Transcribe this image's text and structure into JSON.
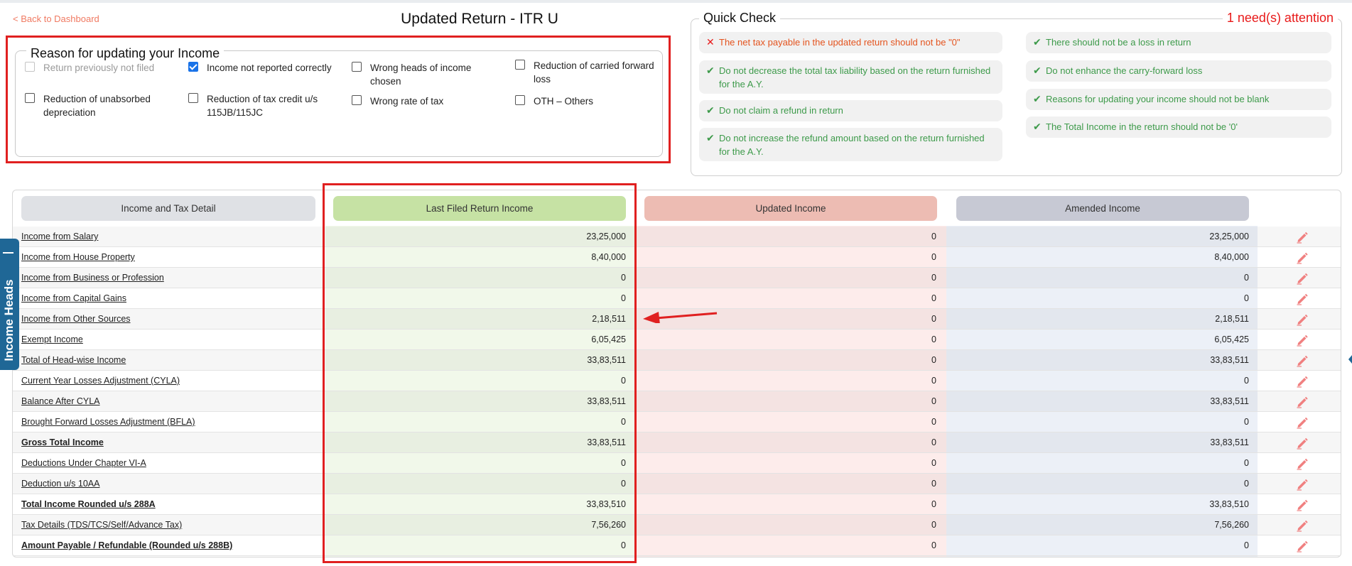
{
  "nav": {
    "back_label": "< Back to Dashboard"
  },
  "page_title": "Updated Return - ITR U",
  "reason": {
    "legend": "Reason for updating your Income",
    "options": [
      {
        "label": "Return previously not filed",
        "checked": false,
        "disabled": true
      },
      {
        "label": "Income not reported correctly",
        "checked": true,
        "disabled": false
      },
      {
        "label": "Wrong heads of income chosen",
        "checked": false,
        "disabled": false
      },
      {
        "label": "Reduction of carried forward loss",
        "checked": false,
        "disabled": false
      },
      {
        "label": "Reduction of unabsorbed depreciation",
        "checked": false,
        "disabled": false
      },
      {
        "label": "Reduction of tax credit u/s 115JB/115JC",
        "checked": false,
        "disabled": false
      },
      {
        "label": "Wrong rate of tax",
        "checked": false,
        "disabled": false
      },
      {
        "label": "OTH – Others",
        "checked": false,
        "disabled": false
      }
    ]
  },
  "quick_check": {
    "title": "Quick Check",
    "attention": "1 need(s) attention",
    "items": [
      {
        "text": "The net tax payable in the updated return should not be \"0\"",
        "status": "error"
      },
      {
        "text": "Do not decrease the total tax liability based on the return furnished for the A.Y.",
        "status": "ok"
      },
      {
        "text": "Do not claim a refund in return",
        "status": "ok"
      },
      {
        "text": "Do not increase the refund amount based on the return furnished for the A.Y.",
        "status": "ok"
      },
      {
        "text": "There should not be a loss in return",
        "status": "ok"
      },
      {
        "text": "Do not enhance the carry-forward loss",
        "status": "ok"
      },
      {
        "text": "Reasons for updating your income should not be blank",
        "status": "ok"
      },
      {
        "text": "The Total Income in the return should not be '0'",
        "status": "ok"
      }
    ]
  },
  "table": {
    "headers": [
      "Income and Tax Detail",
      "Last Filed Return Income",
      "Updated Income",
      "Amended Income"
    ],
    "rows": [
      {
        "label": "Income from Salary",
        "bold": false,
        "last": "23,25,000",
        "updated": "0",
        "amended": "23,25,000"
      },
      {
        "label": "Income from House Property",
        "bold": false,
        "last": "8,40,000",
        "updated": "0",
        "amended": "8,40,000"
      },
      {
        "label": "Income from Business or Profession",
        "bold": false,
        "last": "0",
        "updated": "0",
        "amended": "0"
      },
      {
        "label": "Income from Capital Gains",
        "bold": false,
        "last": "0",
        "updated": "0",
        "amended": "0"
      },
      {
        "label": "Income from Other Sources",
        "bold": false,
        "last": "2,18,511",
        "updated": "0",
        "amended": "2,18,511"
      },
      {
        "label": "Exempt Income",
        "bold": false,
        "last": "6,05,425",
        "updated": "0",
        "amended": "6,05,425"
      },
      {
        "label": "Total of Head-wise Income",
        "bold": false,
        "last": "33,83,511",
        "updated": "0",
        "amended": "33,83,511"
      },
      {
        "label": "Current Year Losses Adjustment (CYLA)",
        "bold": false,
        "last": "0",
        "updated": "0",
        "amended": "0"
      },
      {
        "label": "Balance After CYLA",
        "bold": false,
        "last": "33,83,511",
        "updated": "0",
        "amended": "33,83,511"
      },
      {
        "label": "Brought Forward Losses Adjustment (BFLA)",
        "bold": false,
        "last": "0",
        "updated": "0",
        "amended": "0"
      },
      {
        "label": "Gross Total Income",
        "bold": true,
        "last": "33,83,511",
        "updated": "0",
        "amended": "33,83,511"
      },
      {
        "label": "Deductions Under Chapter VI-A",
        "bold": false,
        "last": "0",
        "updated": "0",
        "amended": "0"
      },
      {
        "label": "Deduction u/s 10AA",
        "bold": false,
        "last": "0",
        "updated": "0",
        "amended": "0"
      },
      {
        "label": "Total Income Rounded u/s 288A",
        "bold": true,
        "last": "33,83,510",
        "updated": "0",
        "amended": "33,83,510"
      },
      {
        "label": "Tax Details (TDS/TCS/Self/Advance Tax)",
        "bold": false,
        "last": "7,56,260",
        "updated": "0",
        "amended": "7,56,260"
      },
      {
        "label": "Amount Payable / Refundable (Rounded u/s 288B)",
        "bold": true,
        "last": "0",
        "updated": "0",
        "amended": "0"
      }
    ]
  },
  "side_tab": {
    "label": "Income Heads"
  },
  "icons": {
    "edit": "pencil-icon",
    "check": "check-icon",
    "error": "cross-icon",
    "arrow": "arrow-left-icon"
  },
  "colors": {
    "accent_red": "#e02020",
    "ok_green": "#3d9a4a",
    "last_filed": "#c6e2a4",
    "updated": "#edbcb3",
    "amended": "#c7c9d4",
    "side_tab": "#1f6796"
  }
}
